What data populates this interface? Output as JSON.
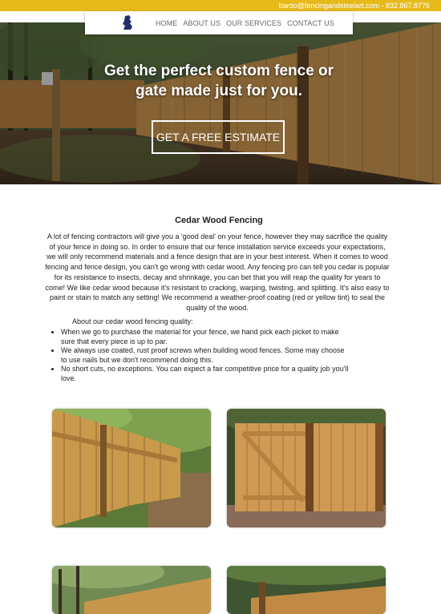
{
  "topbar": {
    "contact": "bardo@fencingandsteelart.com - 832.867.8776"
  },
  "nav": {
    "logo_icon": "knight-logo-icon",
    "items": [
      {
        "label": "HOME"
      },
      {
        "label": "ABOUT US"
      },
      {
        "label": "OUR SERVICES"
      },
      {
        "label": "CONTACT US"
      }
    ]
  },
  "hero": {
    "title_line1": "Get the perfect custom fence or",
    "title_line2": "gate made just for you.",
    "cta_label": "GET A FREE ESTIMATE"
  },
  "content": {
    "title": "Cedar Wood Fencing",
    "intro": "A lot of fencing contractors will give you a 'good deal' on your fence, however they may sacrifice the quality of your fence in doing so. In order to ensure that our fence installation service exceeds your expectations, we will only recommend materials and a fence design that are in your best interest. When it comes to wood fencing and fence design, you can't go wrong with cedar wood. Any fencing pro can tell you cedar is popular for its resistance to insects, decay and shrinkage, you can bet that you will reap the quality for years to come! We like cedar wood because it's resistant to cracking, warping, twisting, and splitting. It's also easy to paint or stain to match any setting! We recommend a weather-proof coating (red or yellow tint) to seal the quality of the wood.",
    "quality_label": "About our cedar wood fencing quality:",
    "quality_items": [
      "When we go to purchase the material for your fence, we hand pick each picket to make sure that every piece is up to par.",
      "We always use coated, rust proof screws when building wood fences. Some may choose to use nails but we don't recommend doing this.",
      "No short cuts, no exceptions. You can expect a fair competitive price for a quality job you'll love."
    ]
  },
  "colors": {
    "topbar": "#e7ba1c",
    "nav_text": "#666666",
    "wood": "#c8943f"
  }
}
